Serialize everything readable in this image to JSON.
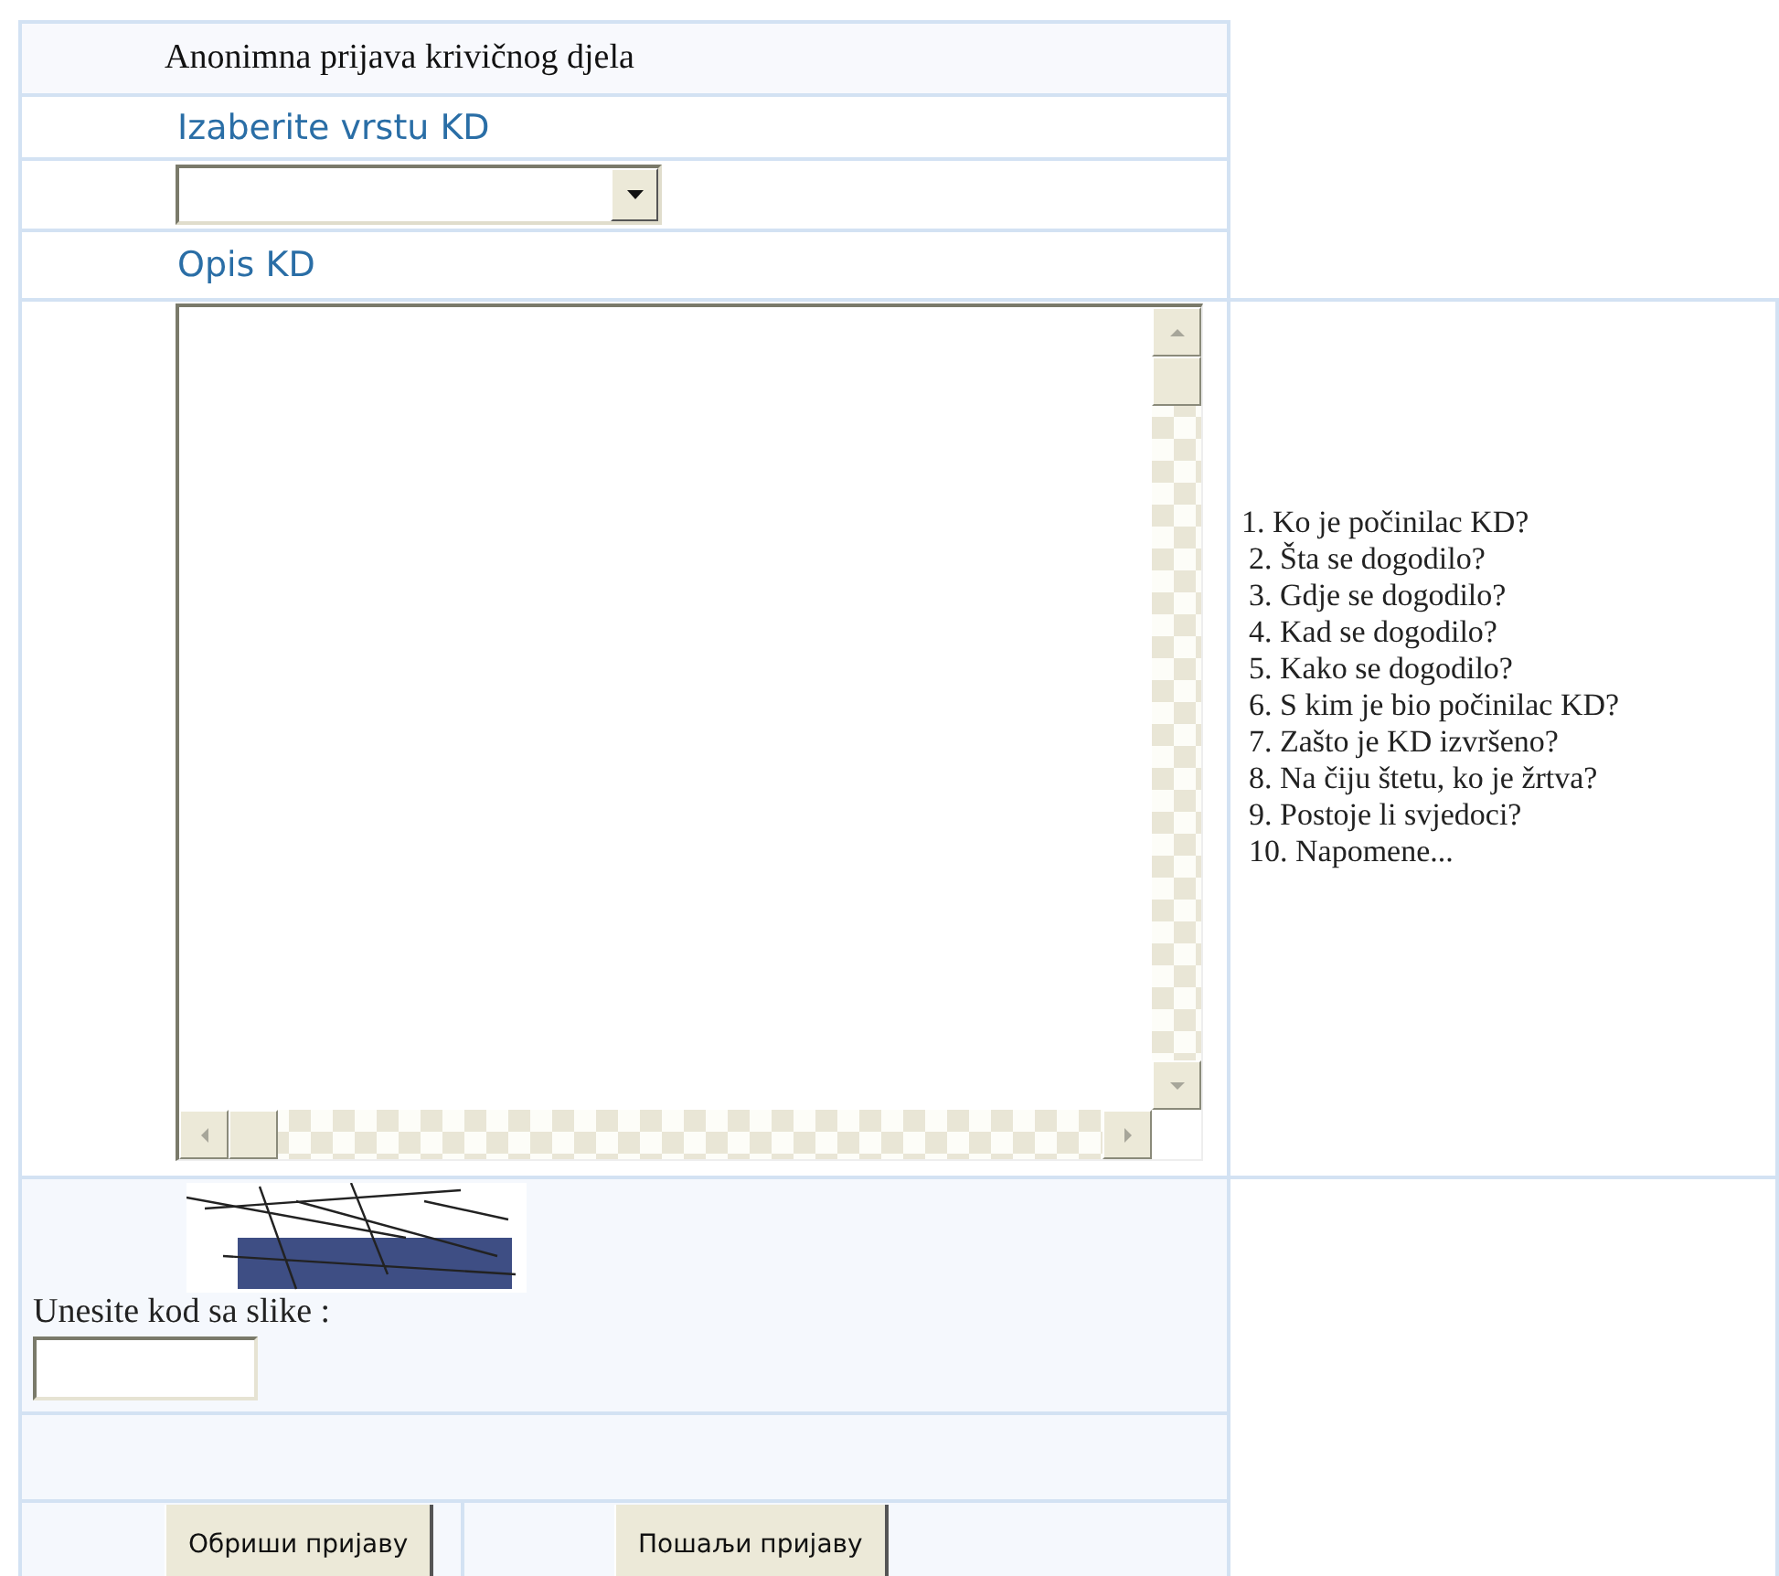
{
  "form": {
    "title": "Anonimna prijava krivičnog djela",
    "type_label": "Izaberite vrstu KD",
    "description_label": "Opis KD",
    "hints": [
      "1. Ko je počinilac KD?",
      "2. Šta se dogodilo?",
      "3. Gdje se dogodilo?",
      "4. Kad se dogodilo?",
      "5. Kako se dogodilo?",
      "6. S kim je bio počinilac KD?",
      "7. Zašto je KD izvršeno?",
      "8. Na čiju štetu, ko je žrtva?",
      "9. Postoje li svjedoci?",
      "10. Napomene..."
    ],
    "captcha_label": "Unesite kod sa slike :",
    "buttons": [
      {
        "label": "Обриши пријаву"
      },
      {
        "label": "Пошаљи пријаву"
      }
    ]
  }
}
